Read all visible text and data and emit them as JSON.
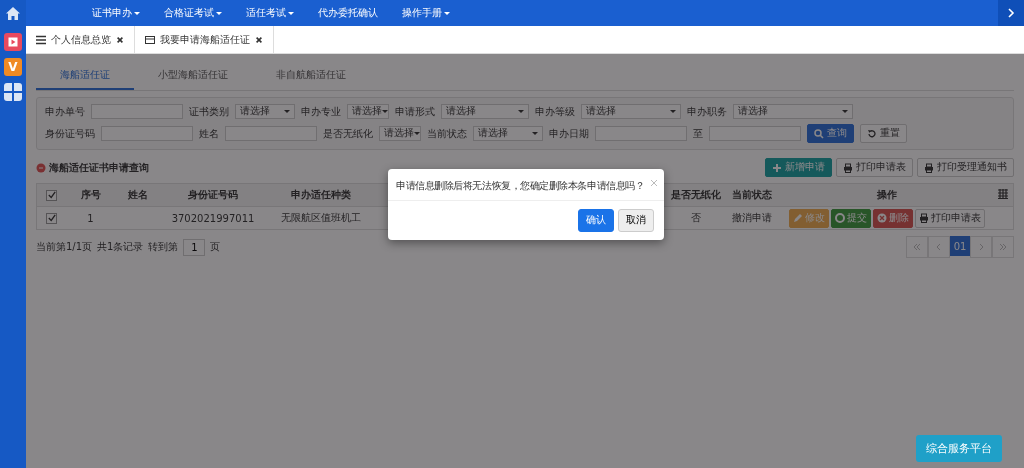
{
  "nav": {
    "items": [
      {
        "label": "证书申办",
        "dropdown": true
      },
      {
        "label": "合格证考试",
        "dropdown": true
      },
      {
        "label": "适任考试",
        "dropdown": true
      },
      {
        "label": "代办委托确认",
        "dropdown": false
      },
      {
        "label": "操作手册",
        "dropdown": true
      }
    ]
  },
  "sidebar": [
    {
      "kind": "video"
    },
    {
      "kind": "letter",
      "label": "V"
    },
    {
      "kind": "grid"
    }
  ],
  "tabs": [
    {
      "label": "个人信息总览",
      "kind": "list",
      "selected": false
    },
    {
      "label": "我要申请海船适任证",
      "kind": "card",
      "selected": true
    }
  ],
  "subtabs": [
    {
      "label": "海船适任证",
      "selected": true
    },
    {
      "label": "小型海船适任证",
      "selected": false
    },
    {
      "label": "非自航船适任证",
      "selected": false
    }
  ],
  "filters": [
    [
      {
        "label": "申办单号",
        "kind": "text"
      },
      {
        "label": "证书类别",
        "kind": "select",
        "value": "请选择"
      },
      {
        "label": "申办专业",
        "kind": "select",
        "value": "请选择"
      },
      {
        "label": "申请形式",
        "kind": "select",
        "value": "请选择"
      },
      {
        "label": "申办等级",
        "kind": "select",
        "value": "请选择"
      },
      {
        "label": "申办职务",
        "kind": "select",
        "value": "请选择"
      }
    ],
    [
      {
        "label": "身份证号码",
        "kind": "text"
      },
      {
        "label": "姓名",
        "kind": "text"
      },
      {
        "label": "是否无纸化",
        "kind": "select",
        "value": "请选择"
      },
      {
        "label": "当前状态",
        "kind": "select",
        "value": "请选择"
      },
      {
        "label": "申办日期",
        "kind": "date_range",
        "separator": "至"
      }
    ]
  ],
  "filter_buttons": [
    {
      "label": "查询",
      "kind": "search"
    },
    {
      "label": "重置",
      "kind": "reset"
    }
  ],
  "section": {
    "title": "海船适任证书申请查询",
    "actions": [
      {
        "label": "新增申请",
        "kind": "add"
      },
      {
        "label": "打印申请表",
        "kind": "print"
      },
      {
        "label": "打印受理通知书",
        "kind": "print"
      }
    ]
  },
  "table": {
    "select_all_checked": true,
    "columns": [
      "序号",
      "姓名",
      "身份证号码",
      "申办适任种类",
      "是否无纸化",
      "当前状态",
      "操作"
    ],
    "rows": [
      {
        "checked": true,
        "index": "1",
        "id_number": "3702021997011",
        "type": "无限航区值班机工",
        "paperless": "否",
        "status": "撤消申请",
        "actions": [
          {
            "label": "修改",
            "kind": "edit"
          },
          {
            "label": "提交",
            "kind": "submit"
          },
          {
            "label": "删除",
            "kind": "delete"
          },
          {
            "label": "打印申请表",
            "kind": "print"
          }
        ]
      }
    ]
  },
  "pagination": {
    "page_info": "当前第1/1页",
    "total": "共1条记录",
    "goto_label": "转到第",
    "goto_value": "1",
    "goto_suffix": "页",
    "pages": [
      {
        "label": "01",
        "selected": true
      }
    ]
  },
  "dialog": {
    "message": "申请信息删除后将无法恢复，您确定删除本条申请信息吗？",
    "buttons": [
      {
        "label": "确认",
        "kind": "primary"
      },
      {
        "label": "取消",
        "kind": "default"
      }
    ]
  },
  "floating_button": "综合服务平台"
}
